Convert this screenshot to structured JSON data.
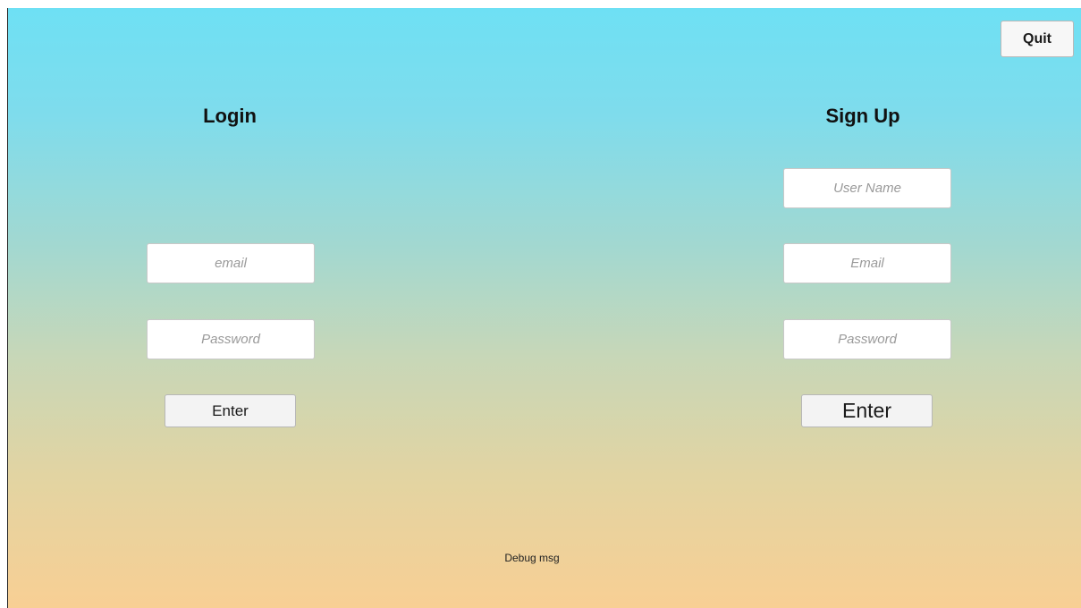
{
  "toolbar": {
    "quit_label": "Quit"
  },
  "login": {
    "title": "Login",
    "email_placeholder": "email",
    "password_placeholder": "Password",
    "enter_label": "Enter"
  },
  "signup": {
    "title": "Sign Up",
    "username_placeholder": "User Name",
    "email_placeholder": "Email",
    "password_placeholder": "Password",
    "enter_label": "Enter"
  },
  "debug": {
    "message": "Debug msg"
  }
}
